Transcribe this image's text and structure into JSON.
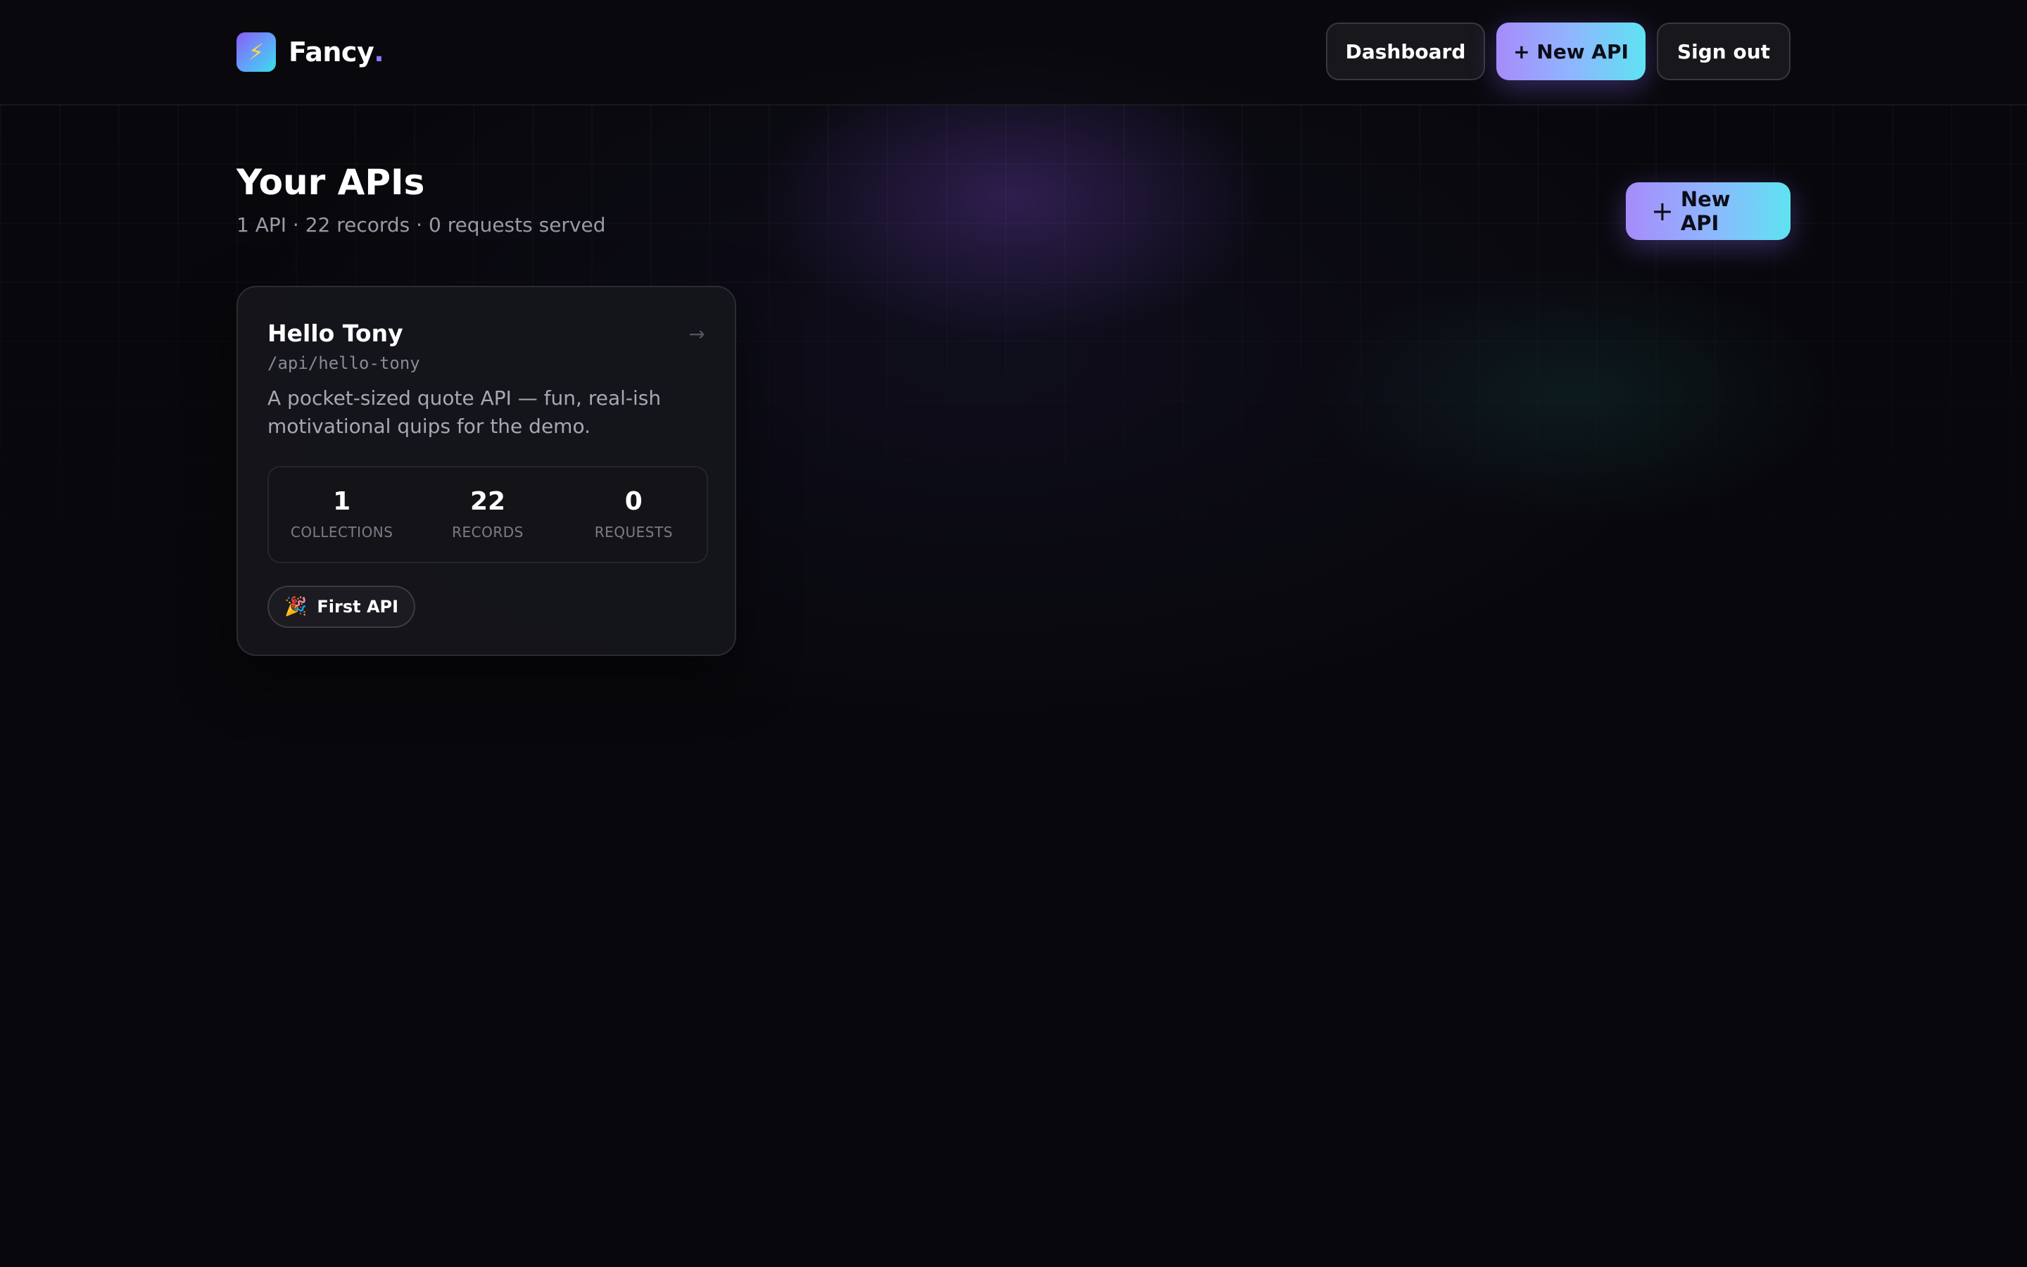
{
  "brand": {
    "icon": "lightning-bolt-icon",
    "glyph": "⚡",
    "name": "Fancy",
    "dot": "."
  },
  "nav": {
    "dashboard": "Dashboard",
    "new_api": "+ New API",
    "sign_out": "Sign out"
  },
  "page": {
    "title": "Your APIs",
    "subtitle": "1 API · 22 records · 0 requests served",
    "new_api_plus": "+",
    "new_api_label": "New API"
  },
  "api_card": {
    "name": "Hello Tony",
    "path": "/api/hello-tony",
    "description": "A pocket-sized quote API — fun, real-ish motivational quips for the demo.",
    "arrow": "→",
    "stats": [
      {
        "value": "1",
        "label": "COLLECTIONS"
      },
      {
        "value": "22",
        "label": "RECORDS"
      },
      {
        "value": "0",
        "label": "REQUESTS"
      }
    ],
    "badge": {
      "icon": "party-popper-icon",
      "glyph": "🎉",
      "label": "First API"
    }
  },
  "colors": {
    "background": "#08080c",
    "accent_start": "#a78bfa",
    "accent_end": "#5ee3f2",
    "card": "#16161c"
  }
}
